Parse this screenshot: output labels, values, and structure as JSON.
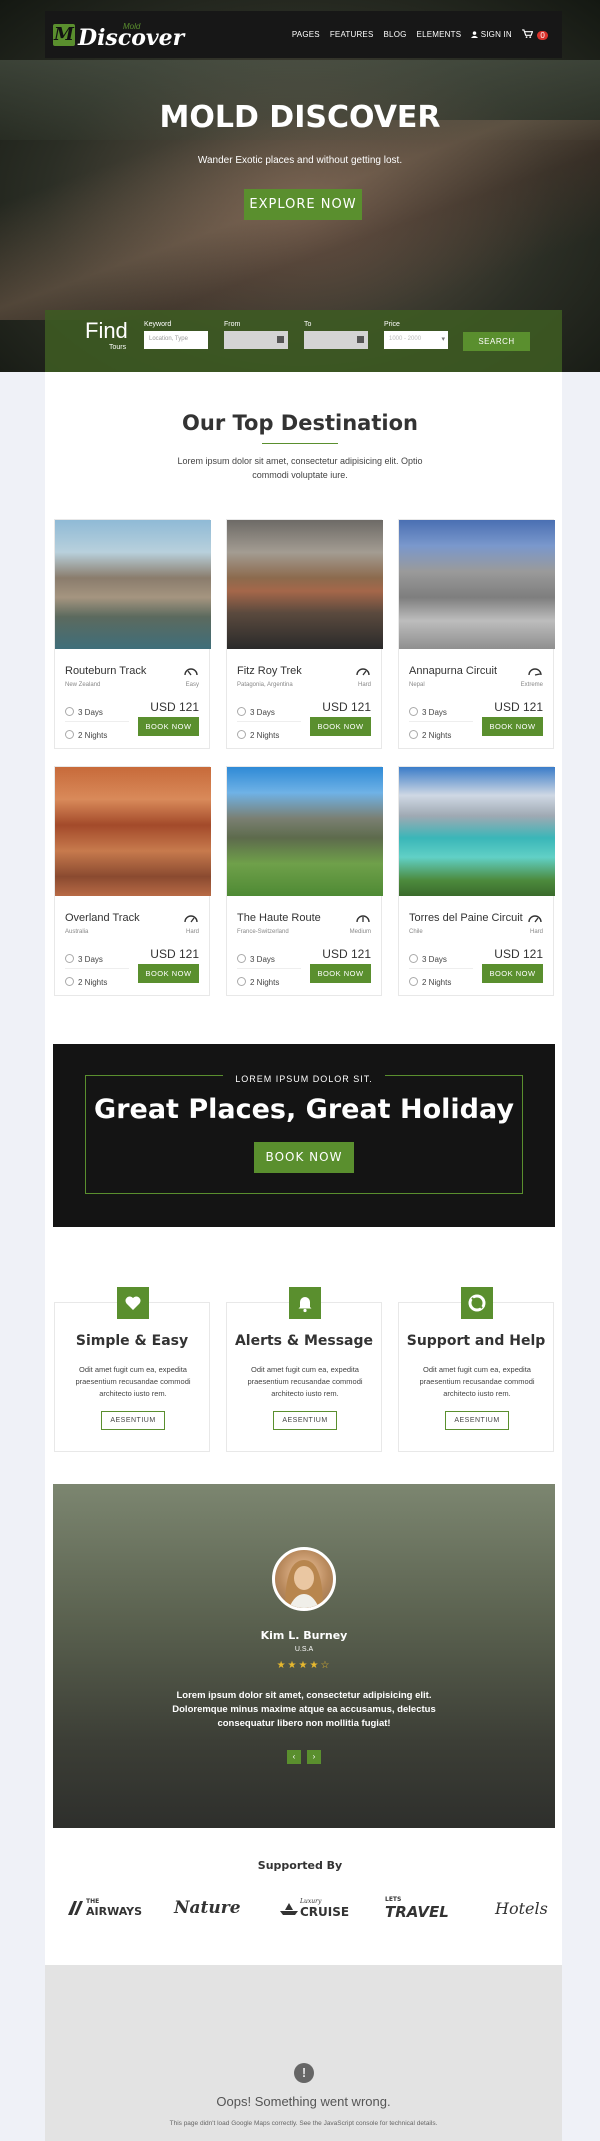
{
  "brand": {
    "small": "Mold",
    "name": "Discover"
  },
  "nav": [
    {
      "label": "PAGES"
    },
    {
      "label": "FEATURES"
    },
    {
      "label": "BLOG"
    },
    {
      "label": "ELEMENTS"
    },
    {
      "label": "SIGN IN"
    }
  ],
  "cart_count": "0",
  "hero": {
    "title": "MOLD DISCOVER",
    "subtitle": "Wander Exotic places and without getting lost.",
    "button": "EXPLORE NOW"
  },
  "find": {
    "title": "Find",
    "subtitle": "Tours",
    "fields": [
      {
        "label": "Keyword",
        "placeholder": "Location, Type"
      },
      {
        "label": "From",
        "placeholder": ""
      },
      {
        "label": "To",
        "placeholder": ""
      },
      {
        "label": "Price",
        "placeholder": "1000 - 2000"
      }
    ],
    "button": "SEARCH"
  },
  "destinations": {
    "title": "Our Top Destination",
    "description": "Lorem ipsum dolor sit amet, consectetur adipisicing elit. Optio commodi voluptate iure.",
    "book_label": "BOOK NOW",
    "cards": [
      {
        "name": "Routeburn Track",
        "location": "New Zealand",
        "difficulty": "Easy",
        "days": "3 Days",
        "nights": "2 Nights",
        "price": "USD 121"
      },
      {
        "name": "Fitz Roy Trek",
        "location": "Patagonia, Argentina",
        "difficulty": "Hard",
        "days": "3 Days",
        "nights": "2 Nights",
        "price": "USD 121"
      },
      {
        "name": "Annapurna Circuit",
        "location": "Nepal",
        "difficulty": "Extreme",
        "days": "3 Days",
        "nights": "2 Nights",
        "price": "USD 121"
      },
      {
        "name": "Overland Track",
        "location": "Australia",
        "difficulty": "Hard",
        "days": "3 Days",
        "nights": "2 Nights",
        "price": "USD 121"
      },
      {
        "name": "The Haute Route",
        "location": "France-Switzerland",
        "difficulty": "Medium",
        "days": "3 Days",
        "nights": "2 Nights",
        "price": "USD 121"
      },
      {
        "name": "Torres del Paine Circuit",
        "location": "Chile",
        "difficulty": "Hard",
        "days": "3 Days",
        "nights": "2 Nights",
        "price": "USD 121"
      }
    ]
  },
  "banner": {
    "small": "LOREM IPSUM DOLOR SIT.",
    "title": "Great Places, Great Holiday",
    "button": "BOOK NOW"
  },
  "features": [
    {
      "icon": "heart-icon",
      "title": "Simple & Easy",
      "text": "Odit amet fugit cum ea, expedita praesentium recusandae commodi architecto iusto rem.",
      "button": "AESENTIUM"
    },
    {
      "icon": "bell-icon",
      "title": "Alerts & Message",
      "text": "Odit amet fugit cum ea, expedita praesentium recusandae commodi architecto iusto rem.",
      "button": "AESENTIUM"
    },
    {
      "icon": "life-ring-icon",
      "title": "Support and Help",
      "text": "Odit amet fugit cum ea, expedita praesentium recusandae commodi architecto iusto rem.",
      "button": "AESENTIUM"
    }
  ],
  "testimonial": {
    "name": "Kim L. Burney",
    "location": "U.S.A",
    "rating": 4,
    "max_rating": 5,
    "stars": "★★★★☆",
    "text": "Lorem ipsum dolor sit amet, consectetur adipisicing elit. Doloremque minus maxime atque ea accusamus, delectus consequatur libero non mollitia fugiat!",
    "prev": "‹",
    "next": "›"
  },
  "supported": {
    "title": "Supported By",
    "logos": [
      {
        "prefix": "THE",
        "name": "AIRWAYS"
      },
      {
        "name": "Nature"
      },
      {
        "prefix": "Luxury",
        "name": "CRUISE"
      },
      {
        "prefix": "LETS",
        "name": "TRAVEL"
      },
      {
        "name": "Hotels"
      }
    ]
  },
  "map_error": {
    "icon": "!",
    "title": "Oops! Something went wrong.",
    "message": "This page didn't load Google Maps correctly. See the JavaScript console for technical details."
  },
  "colors": {
    "accent": "#5a8f2e",
    "dark": "#171717",
    "page_bg": "#eff1f7"
  }
}
